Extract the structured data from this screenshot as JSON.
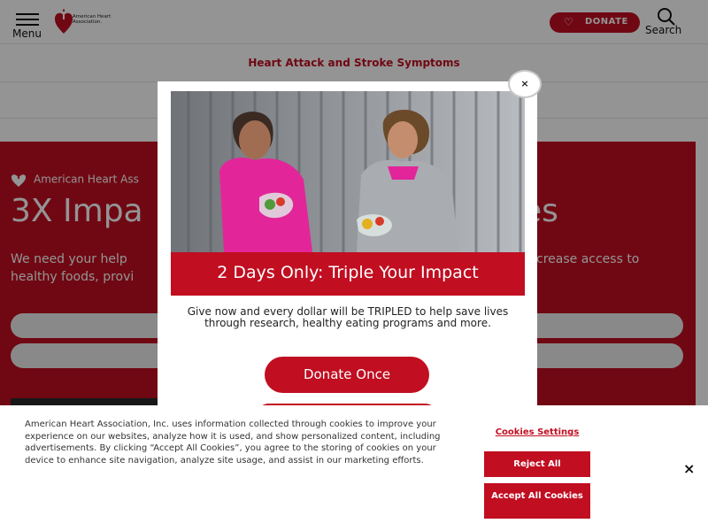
{
  "header": {
    "menu_label": "Menu",
    "logo_text": "American Heart Association.",
    "donate_label": "DONATE",
    "search_label": "Search"
  },
  "subnav": {
    "link": "Heart Attack and Stroke Symptoms"
  },
  "hero": {
    "brand": "American Heart Ass",
    "title_left": "3X Impa",
    "title_right": "es",
    "text_left": "We need your help healthy foods, provi",
    "text_right": "crease access to"
  },
  "modal": {
    "headline": "2 Days Only: Triple Your Impact",
    "body": "Give now and every dollar will be TRIPLED to help save lives through research, healthy eating programs and more.",
    "donate_once_label": "Donate Once",
    "close_label": "×"
  },
  "cookie": {
    "text": "American Heart Association, Inc. uses information collected through cookies to improve your experience on our websites, analyze how it is used, and show personalized content, including advertisements. By clicking “Accept All Cookies”, you agree to the storing of cookies on your device to enhance site navigation, analyze site usage, and assist in our marketing efforts.",
    "settings_label": "Cookies Settings",
    "reject_label": "Reject All",
    "accept_label": "Accept All Cookies",
    "close_label": "×"
  },
  "colors": {
    "brand_red": "#c10e21"
  }
}
